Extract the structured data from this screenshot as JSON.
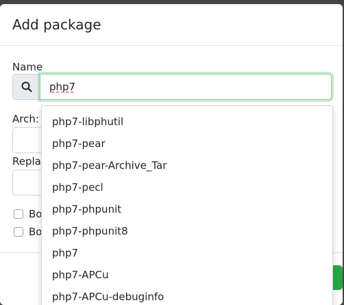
{
  "dialog": {
    "title": "Add package"
  },
  "name_field": {
    "label": "Name",
    "value": "php7",
    "search_icon": "search-icon"
  },
  "arch_field": {
    "label": "Arch:"
  },
  "replace_field": {
    "label": "Repla"
  },
  "checkboxes": [
    {
      "label": "Bo",
      "checked": false
    },
    {
      "label": "Bo",
      "checked": false
    }
  ],
  "suggestions": [
    "php7-libphutil",
    "php7-pear",
    "php7-pear-Archive_Tar",
    "php7-pecl",
    "php7-phpunit",
    "php7-phpunit8",
    "php7",
    "php7-APCu",
    "php7-APCu-debuginfo"
  ],
  "colors": {
    "overlay": "#444444",
    "focus_border": "#8fd19e",
    "primary_button": "#28a745"
  }
}
